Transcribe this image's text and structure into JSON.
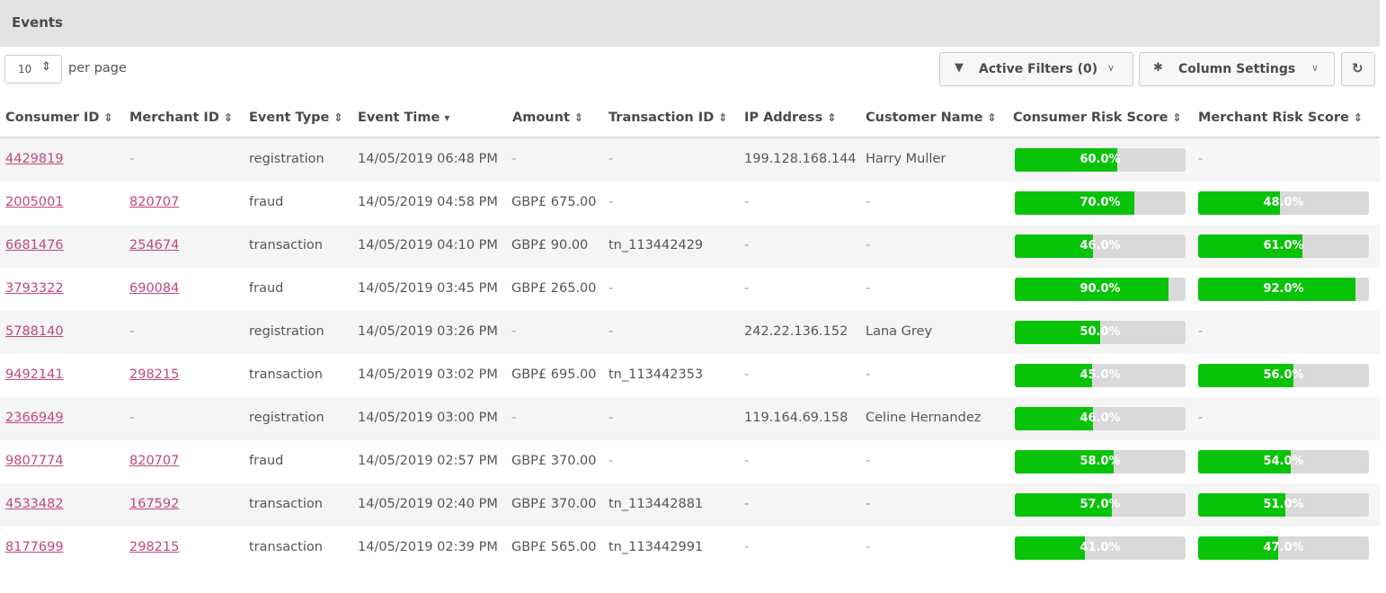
{
  "header": {
    "title": "Events"
  },
  "toolbar": {
    "per_page_value": "10",
    "per_page_label": "per page",
    "filters_label": "Active Filters (0)",
    "columns_label": "Column Settings"
  },
  "table": {
    "columns": [
      "Consumer ID",
      "Merchant ID",
      "Event Type",
      "Event Time",
      "Amount",
      "Transaction ID",
      "IP Address",
      "Customer Name",
      "Consumer Risk Score",
      "Merchant Risk Score"
    ],
    "sorted_column": "Event Time",
    "rows": [
      {
        "consumer_id": "4429819",
        "merchant_id": "-",
        "event_type": "registration",
        "event_time": "14/05/2019 06:48 PM",
        "amount": "-",
        "transaction_id": "-",
        "ip_address": "199.128.168.144",
        "customer_name": "Harry Muller",
        "consumer_risk": 60,
        "consumer_risk_label": "60.0%",
        "merchant_risk": null,
        "merchant_risk_label": "-"
      },
      {
        "consumer_id": "2005001",
        "merchant_id": "820707",
        "event_type": "fraud",
        "event_time": "14/05/2019 04:58 PM",
        "amount": "GBP£ 675.00",
        "transaction_id": "-",
        "ip_address": "-",
        "customer_name": "-",
        "consumer_risk": 70,
        "consumer_risk_label": "70.0%",
        "merchant_risk": 48,
        "merchant_risk_label": "48.0%"
      },
      {
        "consumer_id": "6681476",
        "merchant_id": "254674",
        "event_type": "transaction",
        "event_time": "14/05/2019 04:10 PM",
        "amount": "GBP£ 90.00",
        "transaction_id": "tn_113442429",
        "ip_address": "-",
        "customer_name": "-",
        "consumer_risk": 46,
        "consumer_risk_label": "46.0%",
        "merchant_risk": 61,
        "merchant_risk_label": "61.0%"
      },
      {
        "consumer_id": "3793322",
        "merchant_id": "690084",
        "event_type": "fraud",
        "event_time": "14/05/2019 03:45 PM",
        "amount": "GBP£ 265.00",
        "transaction_id": "-",
        "ip_address": "-",
        "customer_name": "-",
        "consumer_risk": 90,
        "consumer_risk_label": "90.0%",
        "merchant_risk": 92,
        "merchant_risk_label": "92.0%"
      },
      {
        "consumer_id": "5788140",
        "merchant_id": "-",
        "event_type": "registration",
        "event_time": "14/05/2019 03:26 PM",
        "amount": "-",
        "transaction_id": "-",
        "ip_address": "242.22.136.152",
        "customer_name": "Lana Grey",
        "consumer_risk": 50,
        "consumer_risk_label": "50.0%",
        "merchant_risk": null,
        "merchant_risk_label": "-"
      },
      {
        "consumer_id": "9492141",
        "merchant_id": "298215",
        "event_type": "transaction",
        "event_time": "14/05/2019 03:02 PM",
        "amount": "GBP£ 695.00",
        "transaction_id": "tn_113442353",
        "ip_address": "-",
        "customer_name": "-",
        "consumer_risk": 45,
        "consumer_risk_label": "45.0%",
        "merchant_risk": 56,
        "merchant_risk_label": "56.0%"
      },
      {
        "consumer_id": "2366949",
        "merchant_id": "-",
        "event_type": "registration",
        "event_time": "14/05/2019 03:00 PM",
        "amount": "-",
        "transaction_id": "-",
        "ip_address": "119.164.69.158",
        "customer_name": "Celine Hernandez",
        "consumer_risk": 46,
        "consumer_risk_label": "46.0%",
        "merchant_risk": null,
        "merchant_risk_label": "-"
      },
      {
        "consumer_id": "9807774",
        "merchant_id": "820707",
        "event_type": "fraud",
        "event_time": "14/05/2019 02:57 PM",
        "amount": "GBP£ 370.00",
        "transaction_id": "-",
        "ip_address": "-",
        "customer_name": "-",
        "consumer_risk": 58,
        "consumer_risk_label": "58.0%",
        "merchant_risk": 54,
        "merchant_risk_label": "54.0%"
      },
      {
        "consumer_id": "4533482",
        "merchant_id": "167592",
        "event_type": "transaction",
        "event_time": "14/05/2019 02:40 PM",
        "amount": "GBP£ 370.00",
        "transaction_id": "tn_113442881",
        "ip_address": "-",
        "customer_name": "-",
        "consumer_risk": 57,
        "consumer_risk_label": "57.0%",
        "merchant_risk": 51,
        "merchant_risk_label": "51.0%"
      },
      {
        "consumer_id": "8177699",
        "merchant_id": "298215",
        "event_type": "transaction",
        "event_time": "14/05/2019 02:39 PM",
        "amount": "GBP£ 565.00",
        "transaction_id": "tn_113442991",
        "ip_address": "-",
        "customer_name": "-",
        "consumer_risk": 41,
        "consumer_risk_label": "41.0%",
        "merchant_risk": 47,
        "merchant_risk_label": "47.0%"
      }
    ]
  },
  "colors": {
    "accent_link": "#c0477f",
    "risk_fill": "#08c308",
    "risk_track": "#d9d9d9"
  },
  "icons": {
    "per_page": "sort-arrows-icon",
    "filters": "filter-icon",
    "columns": "gear-icon",
    "refresh": "refresh-icon",
    "sort_default": "sort-arrows-icon",
    "sort_active": "caret-down-icon"
  }
}
